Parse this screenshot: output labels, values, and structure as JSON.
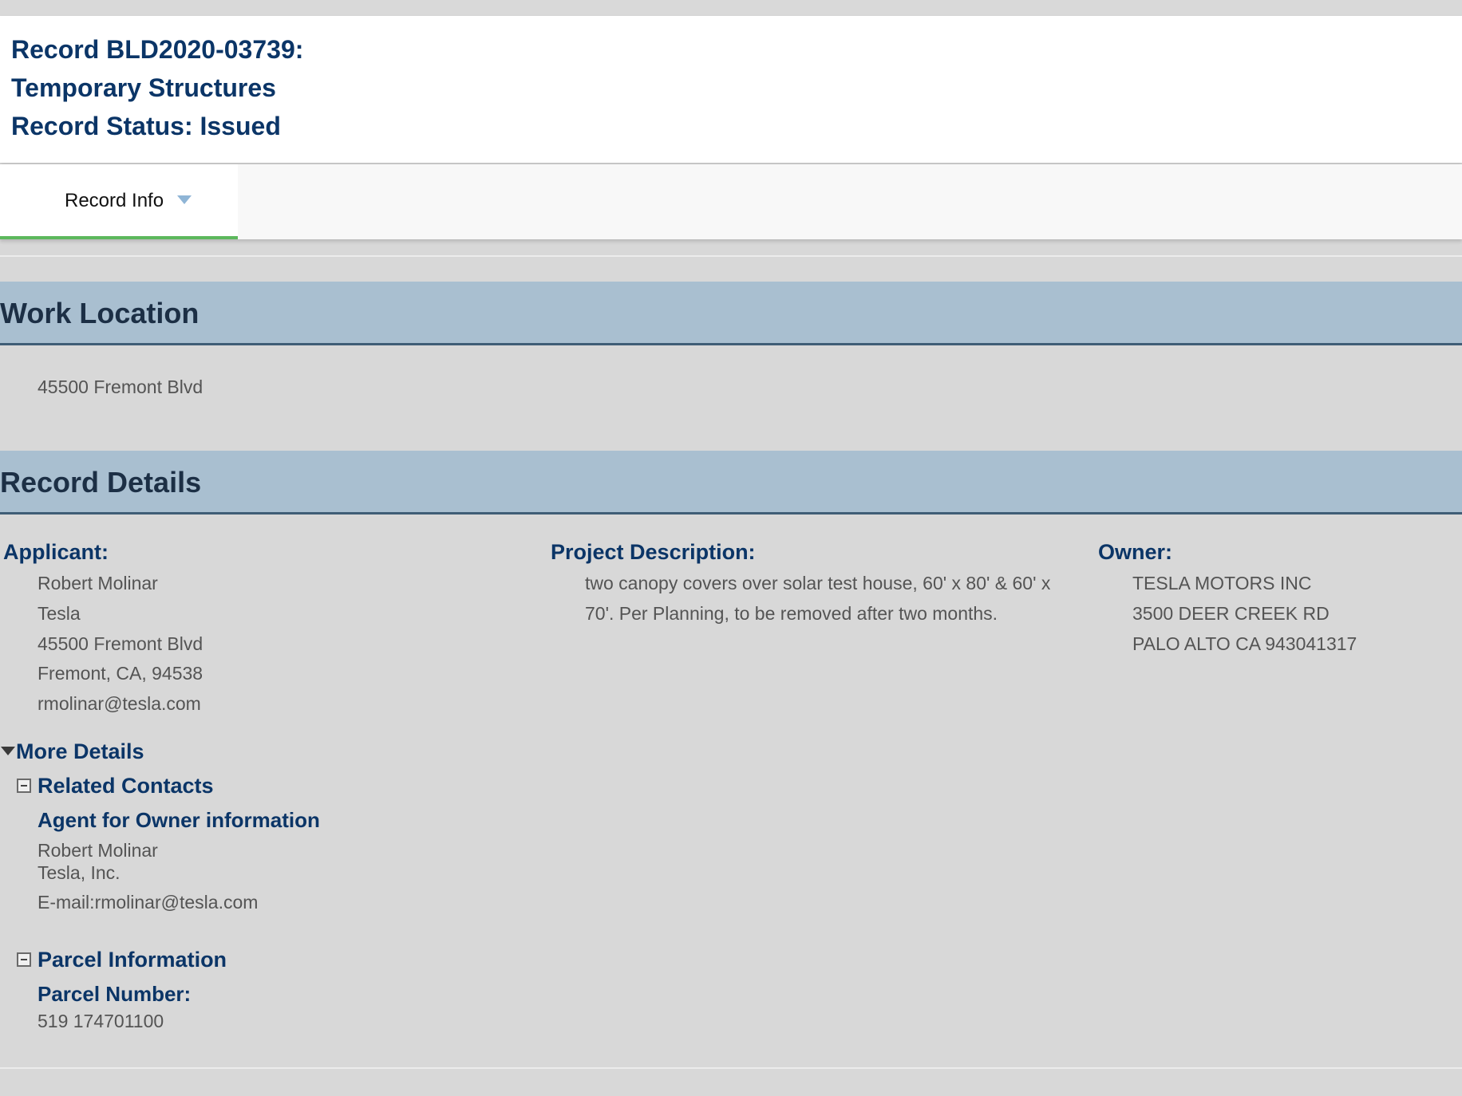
{
  "record": {
    "id_line": "Record BLD2020-03739:",
    "type_line": "Temporary Structures",
    "status_line": "Record Status: Issued"
  },
  "tabs": [
    {
      "label": "Record Info",
      "active": true
    }
  ],
  "work_location": {
    "title": "Work Location",
    "address": "45500 Fremont Blvd"
  },
  "record_details": {
    "title": "Record Details",
    "applicant": {
      "label": "Applicant:",
      "lines": [
        "Robert Molinar",
        "Tesla",
        "45500 Fremont Blvd",
        "Fremont, CA, 94538",
        "rmolinar@tesla.com"
      ]
    },
    "project_description": {
      "label": "Project Description:",
      "lines": [
        "two canopy covers over solar test house, 60' x 80' & 60' x",
        "70'. Per Planning, to be removed after two months."
      ]
    },
    "owner": {
      "label": "Owner:",
      "lines": [
        "TESLA MOTORS INC",
        "3500 DEER CREEK RD",
        "PALO ALTO CA 943041317"
      ]
    }
  },
  "more_details": {
    "label": "More Details",
    "related_contacts": {
      "label": "Related Contacts",
      "agent_heading": "Agent for Owner information",
      "name": "Robert Molinar",
      "company": "Tesla, Inc.",
      "email_label": "E-mail:",
      "email": "rmolinar@tesla.com"
    },
    "parcel_information": {
      "label": "Parcel Information",
      "parcel_number_label": "Parcel Number:",
      "parcel_number": "519 174701100"
    }
  },
  "colors": {
    "heading_blue": "#0b3567",
    "section_bar": "#a9bfd0",
    "section_bar_border": "#3f5d76",
    "tab_active_underline": "#5cb85c",
    "body_text": "#545454",
    "page_background": "#d8d8d8"
  },
  "icons": {
    "tab_dropdown": "caret-down-icon",
    "more_details_toggle": "triangle-down-icon",
    "collapse": "minus-box-icon"
  }
}
